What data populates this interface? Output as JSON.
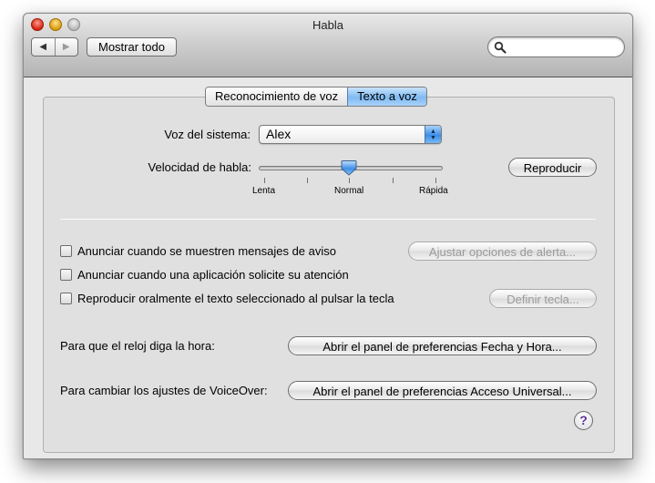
{
  "window": {
    "title": "Habla"
  },
  "toolbar": {
    "show_all_label": "Mostrar todo",
    "search_value": "",
    "search_placeholder": "",
    "back_glyph": "◀",
    "forward_glyph": "▶"
  },
  "tabs": [
    {
      "label": "Reconocimiento de voz",
      "active": false
    },
    {
      "label": "Texto a voz",
      "active": true
    }
  ],
  "voice": {
    "label": "Voz del sistema:",
    "selected": "Alex"
  },
  "rate": {
    "label": "Velocidad de habla:",
    "value_fraction": 0.5,
    "min_label": "Lenta",
    "mid_label": "Normal",
    "max_label": "Rápida"
  },
  "play_button_label": "Reproducir",
  "options": [
    {
      "label": "Anunciar cuando se muestren mensajes de aviso",
      "checked": false
    },
    {
      "label": "Anunciar cuando una aplicación solicite su atención",
      "checked": false
    },
    {
      "label": "Reproducir oralmente el texto seleccionado al pulsar la tecla",
      "checked": false
    }
  ],
  "alert_options_button": "Ajustar opciones de alerta...",
  "define_key_button": "Definir tecla...",
  "clock": {
    "label": "Para que el reloj diga la hora:",
    "button": "Abrir el panel de preferencias Fecha y Hora..."
  },
  "voiceover": {
    "label": "Para cambiar los ajustes de VoiceOver:",
    "button": "Abrir el panel de preferencias Acceso Universal..."
  },
  "help_glyph": "?",
  "colors": {
    "accent_tab": "#7fbaf2",
    "close": "#d4230e",
    "minimize": "#d99a0a",
    "help": "#5b2fa0"
  }
}
